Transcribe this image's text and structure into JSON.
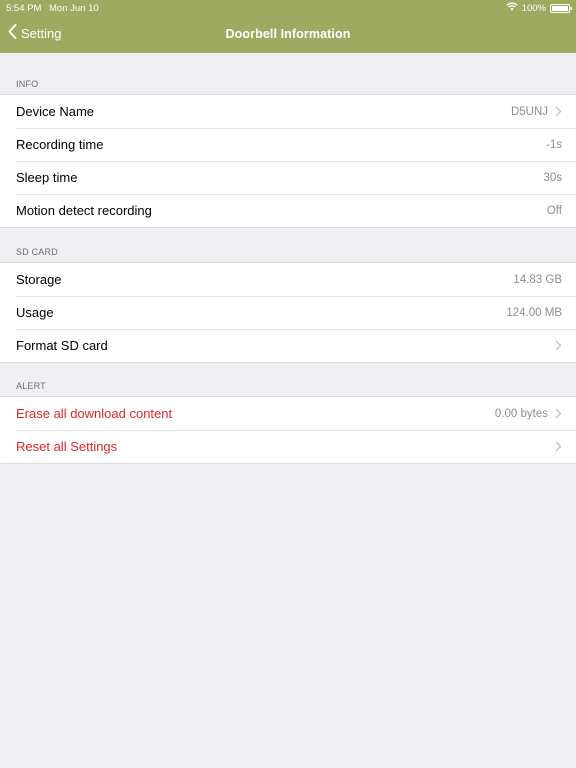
{
  "status_bar": {
    "time": "5:54 PM",
    "date": "Mon Jun 10",
    "battery": "100%",
    "icons": [
      "wifi-icon",
      "battery-icon"
    ]
  },
  "navbar": {
    "back_label": "Setting",
    "title": "Doorbell Information",
    "back_icon": "chevron-left-icon"
  },
  "colors": {
    "nav_background": "#9eaa60",
    "page_background": "#efeff4",
    "danger_text": "#e0252a"
  },
  "sections": {
    "info": {
      "header": "INFO",
      "rows": [
        {
          "label": "Device Name",
          "value": "D5UNJ",
          "disclosure": true
        },
        {
          "label": "Recording time",
          "value": "-1s"
        },
        {
          "label": "Sleep time",
          "value": "30s"
        },
        {
          "label": "Motion detect recording",
          "value": "Off"
        }
      ]
    },
    "sd_card": {
      "header": "SD CARD",
      "rows": [
        {
          "label": "Storage",
          "value": "14.83 GB"
        },
        {
          "label": "Usage",
          "value": "124.00 MB"
        },
        {
          "label": "Format SD card",
          "value": "",
          "disclosure": true
        }
      ]
    },
    "alert": {
      "header": "ALERT",
      "rows": [
        {
          "label": "Erase all download content",
          "value": "0.00 bytes",
          "disclosure": true
        },
        {
          "label": "Reset all Settings",
          "value": "",
          "disclosure": true
        }
      ]
    }
  }
}
